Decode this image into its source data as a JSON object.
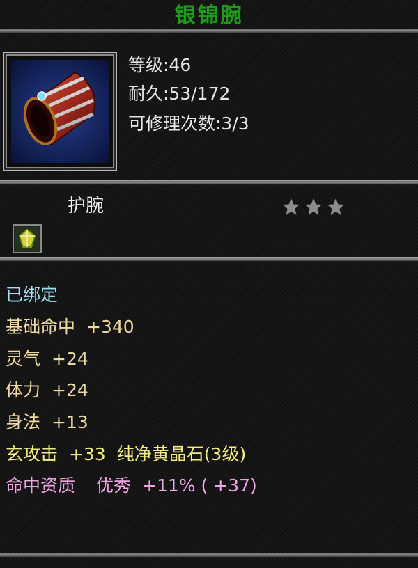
{
  "item": {
    "name": "银锦腕",
    "level_text": "等级:46",
    "durability_text": "耐久:53/172",
    "repair_text": "可修理次数:3/3",
    "type": "护腕",
    "stars": 3
  },
  "attributes": {
    "bound": "已绑定",
    "hit_label": "基础命中",
    "hit_value": "+340",
    "spirit_label": "灵气",
    "spirit_value": "+24",
    "stamina_label": "体力",
    "stamina_value": "+24",
    "agility_label": "身法",
    "agility_value": "+13",
    "xuan_label": "玄攻击",
    "xuan_value": "+33",
    "gem_text": "纯净黄晶石(3级)",
    "quality_label": "命中资质",
    "quality_grade": "优秀",
    "quality_percent": "+11%",
    "quality_bonus": "( +37)"
  },
  "colors": {
    "title": "#1f9a1f",
    "bound": "#9fe0f0",
    "base": "#f0d9a0",
    "xuan": "#f4ec80",
    "quality": "#f0a6e6",
    "star": "#8c8c8c"
  }
}
